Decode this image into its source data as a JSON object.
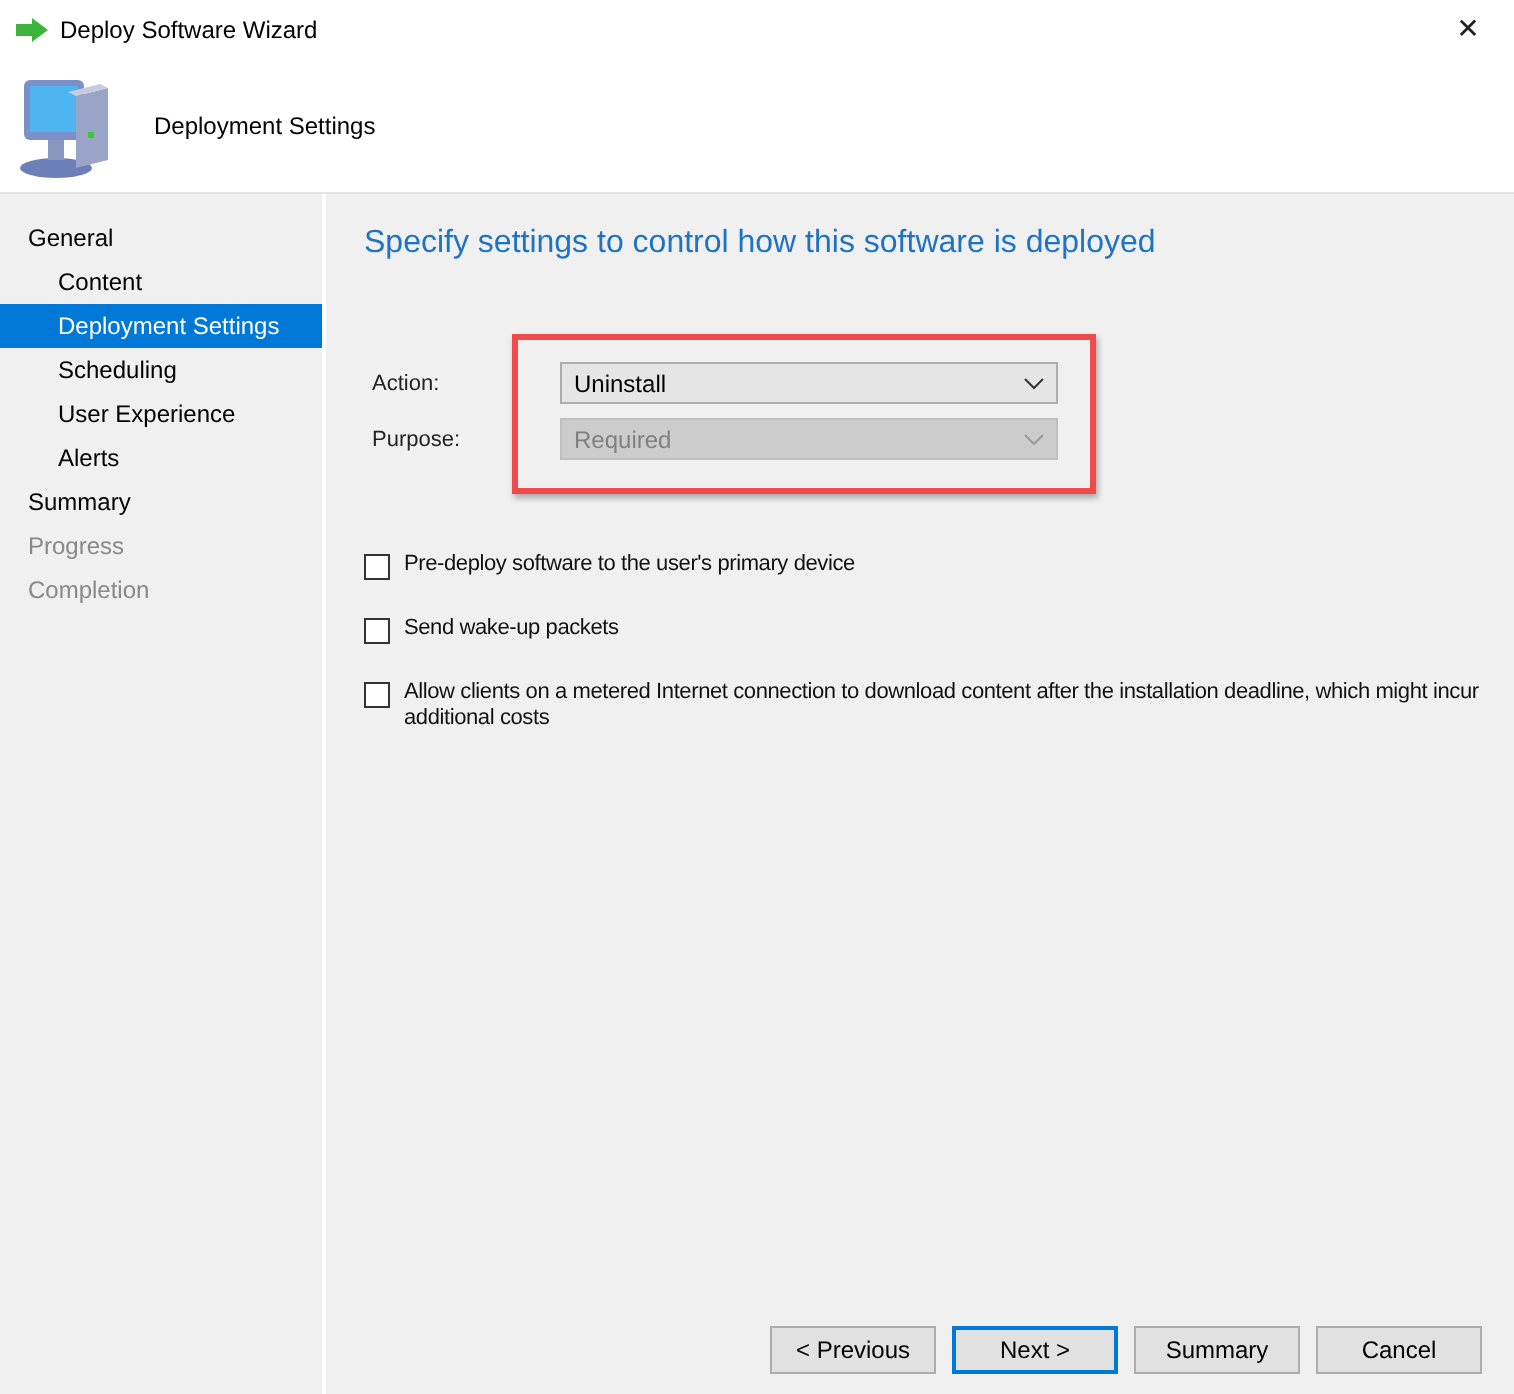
{
  "window": {
    "title": "Deploy Software Wizard",
    "close": "✕"
  },
  "header": {
    "title": "Deployment Settings"
  },
  "sidebar": {
    "items": [
      {
        "label": "General",
        "selected": false,
        "disabled": false,
        "children": [
          {
            "label": "Content",
            "selected": false,
            "disabled": false
          },
          {
            "label": "Deployment Settings",
            "selected": true,
            "disabled": false
          },
          {
            "label": "Scheduling",
            "selected": false,
            "disabled": false
          },
          {
            "label": "User Experience",
            "selected": false,
            "disabled": false
          },
          {
            "label": "Alerts",
            "selected": false,
            "disabled": false
          }
        ]
      },
      {
        "label": "Summary",
        "selected": false,
        "disabled": false
      },
      {
        "label": "Progress",
        "selected": false,
        "disabled": true
      },
      {
        "label": "Completion",
        "selected": false,
        "disabled": true
      }
    ]
  },
  "main": {
    "heading": "Specify settings to control how this software is deployed",
    "fields_highlighted": true,
    "fields": [
      {
        "label": "Action:",
        "value": "Uninstall",
        "disabled": false
      },
      {
        "label": "Purpose:",
        "value": "Required",
        "disabled": true
      }
    ],
    "checkboxes": [
      {
        "label": "Pre-deploy software to the user's primary device",
        "checked": false
      },
      {
        "label": "Send wake-up packets",
        "checked": false
      },
      {
        "label": "Allow clients on a metered Internet connection to download content after the installation deadline, which might incur additional costs",
        "checked": false
      }
    ]
  },
  "buttons": [
    {
      "label": "< Previous",
      "default": false
    },
    {
      "label": "Next >",
      "default": true
    },
    {
      "label": "Summary",
      "default": false
    },
    {
      "label": "Cancel",
      "default": false
    }
  ]
}
